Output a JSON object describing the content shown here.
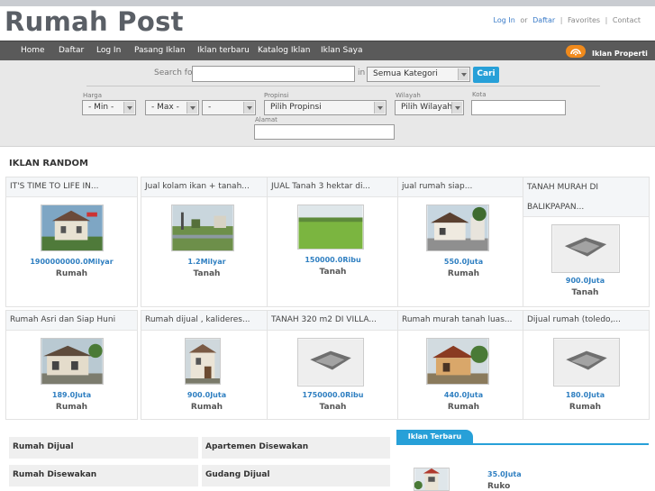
{
  "header": {
    "logo": "Rumah Post",
    "links": {
      "login": "Log In",
      "or": "or",
      "daftar": "Daftar",
      "favorites": "Favorites",
      "contact": "Contact"
    }
  },
  "nav": {
    "items": [
      "Home",
      "Daftar",
      "Log In",
      "Pasang Iklan",
      "Iklan terbaru",
      "Katalog Iklan",
      "Iklan Saya"
    ],
    "right_label": "Iklan Properti"
  },
  "search": {
    "label": "Search for",
    "in_label": "in",
    "category_value": "Semua Kategori",
    "button": "Cari",
    "harga_label": "Harga",
    "min_value": "- Min -",
    "max_value": "- Max -",
    "extra_value": "-",
    "propinsi_label": "Propinsi",
    "propinsi_value": "Pilih Propinsi",
    "wilayah_label": "Wilayah",
    "wilayah_value": "Pilih Wilayah",
    "kota_label": "Kota",
    "alamat_label": "Alamat"
  },
  "section_title": "IKLAN RANDOM",
  "listings": [
    {
      "title": "IT'S TIME TO LIFE IN...",
      "price": "1900000000.0Milyar",
      "category": "Rumah",
      "image": "house-photo"
    },
    {
      "title": "Jual kolam ikan + tanah...",
      "price": "1.2Milyar",
      "category": "Tanah",
      "image": "land-photo"
    },
    {
      "title": "JUAL Tanah 3 hektar di...",
      "price": "150000.0Ribu",
      "category": "Tanah",
      "image": "field-photo"
    },
    {
      "title": "jual rumah siap...",
      "price": "550.0Juta",
      "category": "Rumah",
      "image": "house-photo"
    },
    {
      "title": "TANAH MURAH DI BALIKPAPAN...",
      "price": "900.0Juta",
      "category": "Tanah",
      "image": "placeholder-photo"
    },
    {
      "title": "Rumah Asri dan Siap Huni",
      "price": "189.0Juta",
      "category": "Rumah",
      "image": "house-photo"
    },
    {
      "title": "Rumah dijual , kalideres...",
      "price": "900.0Juta",
      "category": "Rumah",
      "image": "house-photo"
    },
    {
      "title": "TANAH 320 m2 DI VILLA...",
      "price": "1750000.0Ribu",
      "category": "Tanah",
      "image": "placeholder-photo"
    },
    {
      "title": "Rumah murah tanah luas...",
      "price": "440.0Juta",
      "category": "Rumah",
      "image": "house-photo"
    },
    {
      "title": "Dijual rumah (toledo,...",
      "price": "180.0Juta",
      "category": "Rumah",
      "image": "placeholder-photo"
    }
  ],
  "categories": [
    "Rumah Dijual",
    "Apartemen Disewakan",
    "Rumah Disewakan",
    "Gudang Dijual"
  ],
  "latest": {
    "tab_label": "Iklan Terbaru",
    "item": {
      "price": "35.0Juta",
      "category": "Ruko"
    }
  },
  "colors": {
    "accent": "#27a0d8",
    "price": "#2f7fc1",
    "navbar": "#5a5a5a"
  }
}
